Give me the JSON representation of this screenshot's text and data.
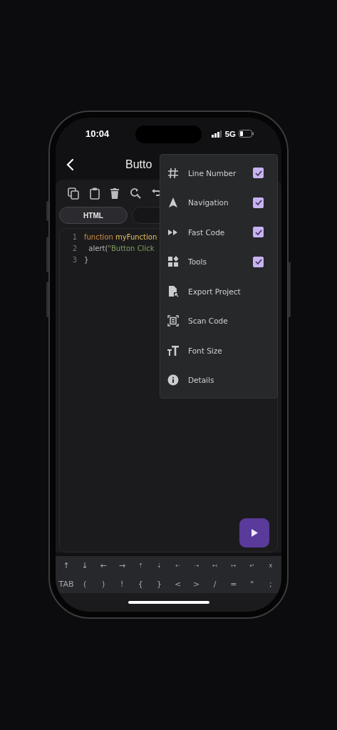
{
  "status_bar": {
    "time": "10:04",
    "network": "5G"
  },
  "header": {
    "title": "Butto"
  },
  "editor": {
    "tabs": [
      {
        "label": "HTML",
        "selected": true
      },
      {
        "selected": false
      }
    ],
    "lines": [
      {
        "number": "1",
        "tokens": [
          {
            "kind": "keyword",
            "text": "function"
          },
          {
            "kind": "name",
            "text": "myFunction"
          }
        ]
      },
      {
        "number": "2",
        "tokens": [
          {
            "kind": "plain",
            "text": "  alert("
          },
          {
            "kind": "string",
            "text": "\"Button Click"
          }
        ]
      },
      {
        "number": "3",
        "tokens": [
          {
            "kind": "plain",
            "text": "}"
          }
        ]
      }
    ]
  },
  "menu": {
    "items": [
      {
        "label": "Line Number",
        "kind": "toggle",
        "checked": true
      },
      {
        "label": "Navigation",
        "kind": "toggle",
        "checked": true
      },
      {
        "label": "Fast Code",
        "kind": "toggle",
        "checked": true
      },
      {
        "label": "Tools",
        "kind": "toggle",
        "checked": true
      },
      {
        "label": "Export Project",
        "kind": "action"
      },
      {
        "label": "Scan Code",
        "kind": "action"
      },
      {
        "label": "Font Size",
        "kind": "action"
      },
      {
        "label": "Details",
        "kind": "action"
      }
    ]
  },
  "keyboard": {
    "rows": [
      [
        "↑",
        "↓",
        "←",
        "→",
        "⇡",
        "⇣",
        "⇠",
        "⇢",
        "↤",
        "↦",
        "↵",
        "x"
      ],
      [
        "TAB",
        "(",
        ")",
        "!",
        "{",
        "}",
        "<",
        ">",
        "/",
        "=",
        "\"",
        ";"
      ]
    ]
  }
}
